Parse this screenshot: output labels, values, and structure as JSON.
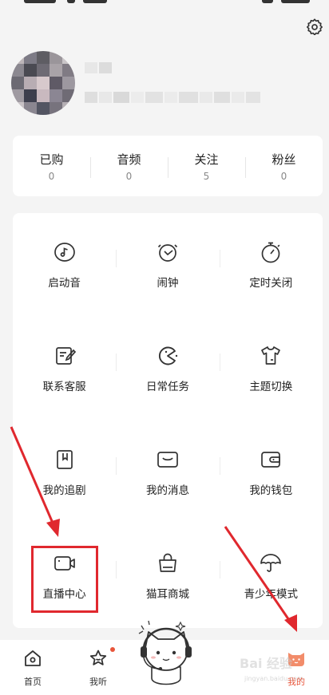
{
  "stats": [
    {
      "label": "已购",
      "value": "0"
    },
    {
      "label": "音频",
      "value": "0"
    },
    {
      "label": "关注",
      "value": "5"
    },
    {
      "label": "粉丝",
      "value": "0"
    }
  ],
  "grid": [
    {
      "label": "启动音",
      "icon": "music-note-icon"
    },
    {
      "label": "闹钟",
      "icon": "alarm-clock-icon"
    },
    {
      "label": "定时关闭",
      "icon": "timer-icon"
    },
    {
      "label": "联系客服",
      "icon": "edit-note-icon"
    },
    {
      "label": "日常任务",
      "icon": "pacman-icon"
    },
    {
      "label": "主题切换",
      "icon": "tshirt-icon"
    },
    {
      "label": "我的追剧",
      "icon": "bookmark-icon"
    },
    {
      "label": "我的消息",
      "icon": "message-box-icon"
    },
    {
      "label": "我的钱包",
      "icon": "wallet-icon"
    },
    {
      "label": "直播中心",
      "icon": "video-camera-icon"
    },
    {
      "label": "猫耳商城",
      "icon": "shopping-bag-icon"
    },
    {
      "label": "青少年模式",
      "icon": "umbrella-icon"
    }
  ],
  "nav": {
    "home": "首页",
    "listen": "我听",
    "me": "我的"
  },
  "watermark": {
    "main": "Bai 经验",
    "sub": "jingyan.baidu.com"
  },
  "colors": {
    "accent": "#e8553a",
    "annotation": "#e0282e"
  }
}
